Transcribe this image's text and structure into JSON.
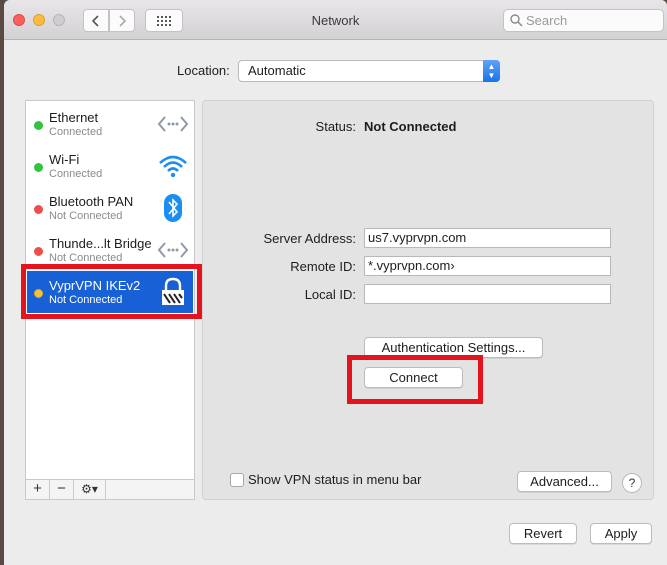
{
  "window": {
    "title": "Network",
    "search_placeholder": "Search"
  },
  "location": {
    "label": "Location:",
    "value": "Automatic"
  },
  "services": [
    {
      "name": "Ethernet",
      "status": "Connected",
      "dot": "green",
      "icon": "ethernet-arrows-icon"
    },
    {
      "name": "Wi-Fi",
      "status": "Connected",
      "dot": "green",
      "icon": "wifi-icon"
    },
    {
      "name": "Bluetooth PAN",
      "status": "Not Connected",
      "dot": "red",
      "icon": "bluetooth-icon"
    },
    {
      "name": "Thunde...lt Bridge",
      "status": "Not Connected",
      "dot": "red",
      "icon": "thunderbolt-arrows-icon"
    },
    {
      "name": "VyprVPN IKEv2",
      "status": "Not Connected",
      "dot": "yellow",
      "icon": "vpn-lock-icon",
      "selected": true
    }
  ],
  "sidebar_footer": {
    "add": "+",
    "remove": "−",
    "action": "⚙▾"
  },
  "detail": {
    "status_label": "Status:",
    "status_value": "Not Connected",
    "server_address_label": "Server Address:",
    "server_address_value": "us7.vyprvpn.com",
    "remote_id_label": "Remote ID:",
    "remote_id_value": "*.vyprvpn.com›",
    "local_id_label": "Local ID:",
    "local_id_value": "",
    "auth_settings_button": "Authentication Settings...",
    "connect_button": "Connect",
    "show_vpn_status_label": "Show VPN status in menu bar",
    "advanced_button": "Advanced...",
    "help_button": "?"
  },
  "bottom": {
    "revert_button": "Revert",
    "apply_button": "Apply"
  },
  "colors": {
    "selection": "#1860d6",
    "highlight_box": "#e3141d"
  }
}
